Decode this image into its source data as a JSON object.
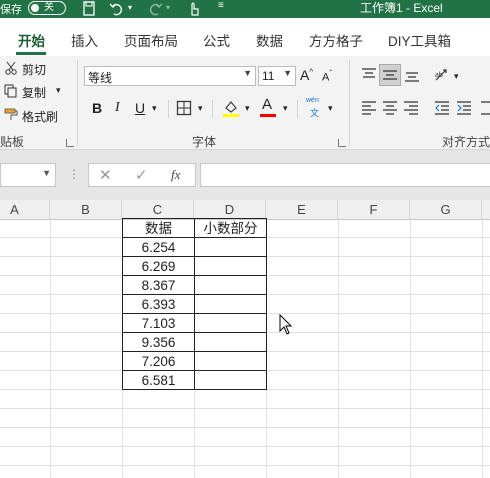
{
  "titlebar": {
    "autosave_label": "保存",
    "autosave_state": "关",
    "window_title": "工作簿1 - Excel"
  },
  "tabs": [
    "开始",
    "插入",
    "页面布局",
    "公式",
    "数据",
    "方方格子",
    "DIY工具箱"
  ],
  "active_tab": "开始",
  "clipboard": {
    "cut": "剪切",
    "copy": "复制",
    "format_painter": "格式刷",
    "group_label": "贴板"
  },
  "font_group": {
    "font_name": "等线",
    "font_size": "11",
    "group_label": "字体",
    "bold": "B",
    "italic": "I",
    "underline": "U",
    "font_color_letter": "A",
    "phonetic_top": "wén",
    "phonetic_bottom": "文",
    "fill_color": "#ffff00",
    "font_color": "#ff0000"
  },
  "alignment_group": {
    "group_label": "对齐方式"
  },
  "formula_bar": {
    "name_box": "",
    "fx_label": "fx",
    "formula": ""
  },
  "columns": [
    "A",
    "B",
    "C",
    "D",
    "E",
    "F",
    "G"
  ],
  "table": {
    "headers": [
      "数据",
      "小数部分"
    ],
    "values": [
      "6.254",
      "6.269",
      "8.367",
      "6.393",
      "7.103",
      "9.356",
      "7.206",
      "6.581"
    ]
  }
}
